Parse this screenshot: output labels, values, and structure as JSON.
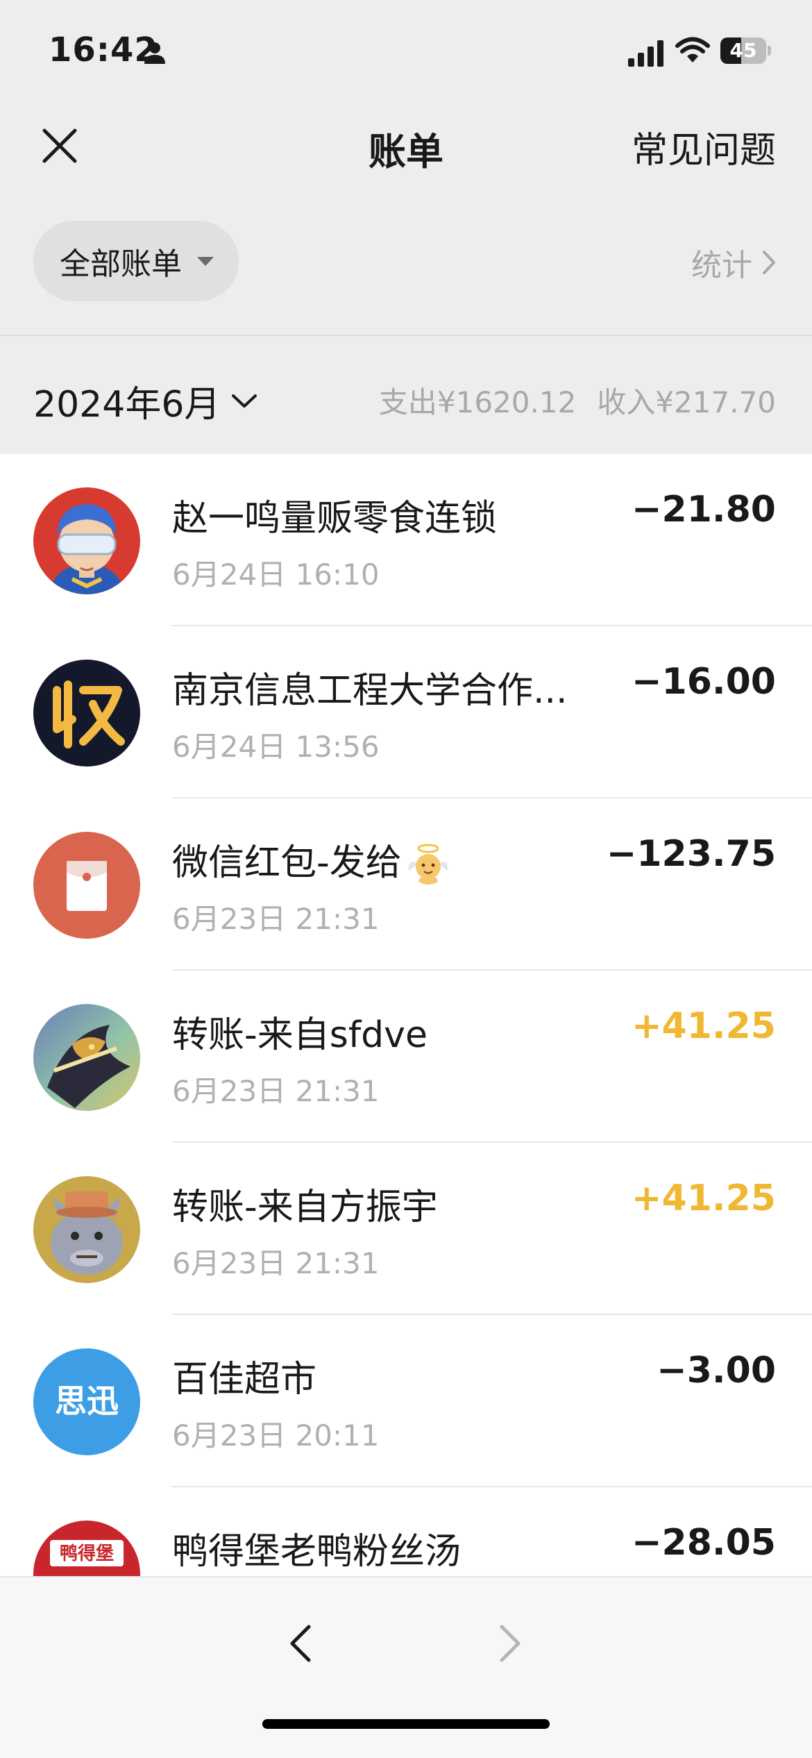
{
  "status_bar": {
    "time": "16:42",
    "battery": "45",
    "battery_level": 0.45
  },
  "nav": {
    "title": "账单",
    "faq": "常见问题"
  },
  "filter": {
    "label": "全部账单",
    "stats": "统计"
  },
  "month": {
    "label": "2024年6月",
    "expense": "支出¥1620.12",
    "income": "收入¥217.70"
  },
  "transactions": [
    {
      "title": "赵一鸣量贩零食连锁",
      "time": "6月24日 16:10",
      "amount": "−21.80",
      "type": "expense",
      "avatar": "cartoon-hero-avatar"
    },
    {
      "title": "南京信息工程大学合作...",
      "time": "6月24日 13:56",
      "amount": "−16.00",
      "type": "expense",
      "avatar": "shou-collection-avatar"
    },
    {
      "title": "微信红包-发给",
      "time": "6月23日 21:31",
      "amount": "−123.75",
      "type": "expense",
      "avatar": "red-packet-avatar",
      "emoji": "angel-baby-emoji"
    },
    {
      "title": "转账-来自sfdve",
      "time": "6月23日 21:31",
      "amount": "+41.25",
      "type": "income",
      "avatar": "game-hero-avatar"
    },
    {
      "title": "转账-来自方振宇",
      "time": "6月23日 21:31",
      "amount": "+41.25",
      "type": "income",
      "avatar": "cartoon-wolf-avatar"
    },
    {
      "title": "百佳超市",
      "time": "6月23日 20:11",
      "amount": "−3.00",
      "type": "expense",
      "avatar": "sixun-logo-avatar",
      "avatar_text": "思迅"
    },
    {
      "title": "鸭得堡老鸭粉丝汤",
      "time": "",
      "amount": "−28.05",
      "type": "expense",
      "avatar": "yadebao-logo-avatar",
      "avatar_text": "鸭得堡"
    }
  ],
  "colors": {
    "background": "#ededed",
    "income": "#f0b832",
    "expense": "#191919",
    "muted": "#a8a8a8"
  }
}
